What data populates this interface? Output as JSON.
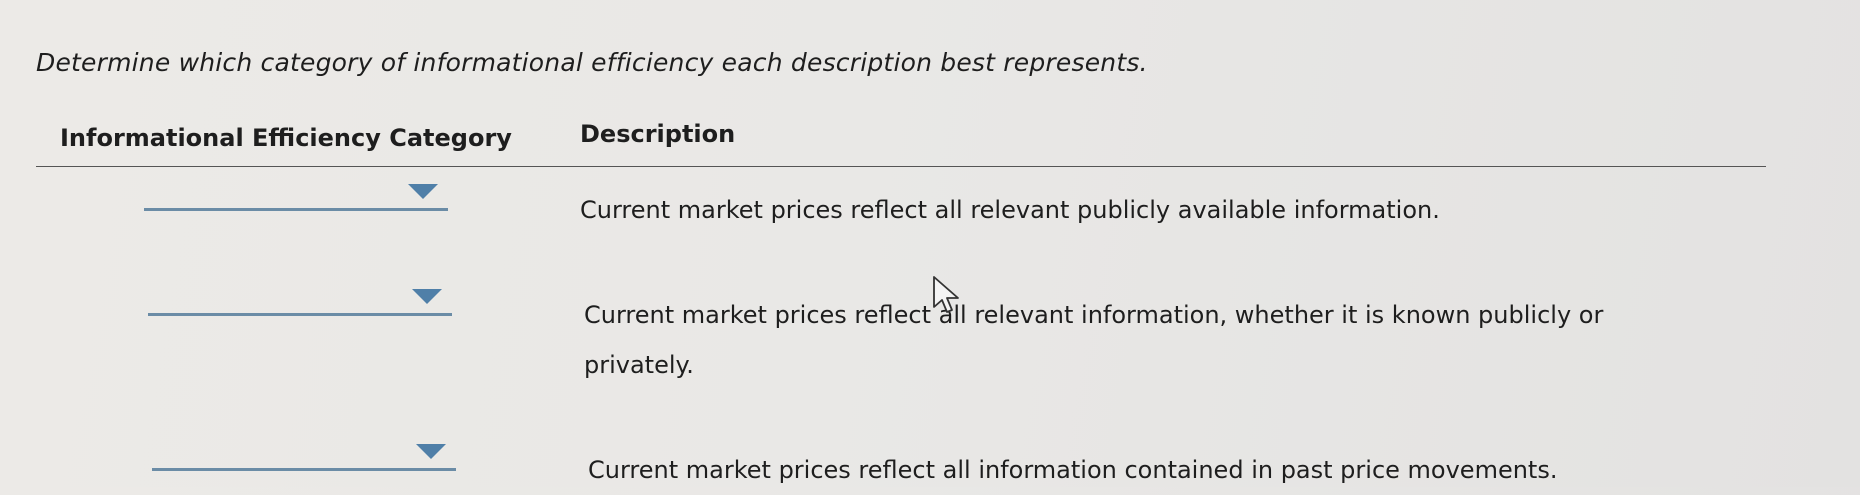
{
  "instructions": "Determine which category of informational efficiency each description best represents.",
  "table": {
    "headers": {
      "category": "Informational Efficiency Category",
      "description": "Description"
    },
    "rows": [
      {
        "selected_category": "",
        "description_line1": "Current market prices reflect all relevant publicly available information.",
        "description_line2": ""
      },
      {
        "selected_category": "",
        "description_line1": "Current market prices reflect all relevant information, whether it is known publicly or",
        "description_line2": "privately."
      },
      {
        "selected_category": "",
        "description_line1": "Current market prices reflect all information contained in past price movements.",
        "description_line2": ""
      }
    ]
  },
  "colors": {
    "dropdown_underline": "#6b8ca6",
    "dropdown_caret": "#4f7fa8"
  },
  "icons": {
    "dropdown": "triangle-down",
    "cursor": "arrow-pointer"
  }
}
